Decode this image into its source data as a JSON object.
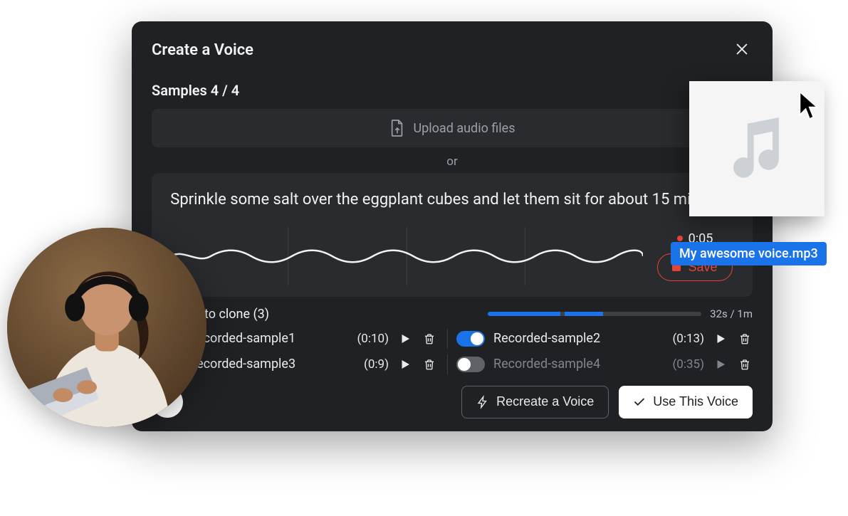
{
  "modal": {
    "title": "Create a Voice",
    "samples_counter": "Samples 4 / 4",
    "upload_label": "Upload audio files",
    "or": "or",
    "prompt_text": "Sprinkle some salt over the eggplant cubes and let them sit for about 15 minutes.",
    "recording_time": "0:05",
    "save_label": "Save"
  },
  "clone": {
    "label": "Samples to clone (3)",
    "progress_text": "32s / 1m"
  },
  "samples": [
    {
      "name": "Recorded-sample1",
      "duration": "(0:10)",
      "on": true
    },
    {
      "name": "Recorded-sample2",
      "duration": "(0:13)",
      "on": true
    },
    {
      "name": "Recorded-sample3",
      "duration": "(0:9)",
      "on": true
    },
    {
      "name": "Recorded-sample4",
      "duration": "(0:35)",
      "on": false
    }
  ],
  "footer": {
    "recreate_label": "Recreate a Voice",
    "use_label": "Use This Voice"
  },
  "drag": {
    "filename": "My awesome voice.mp3"
  }
}
